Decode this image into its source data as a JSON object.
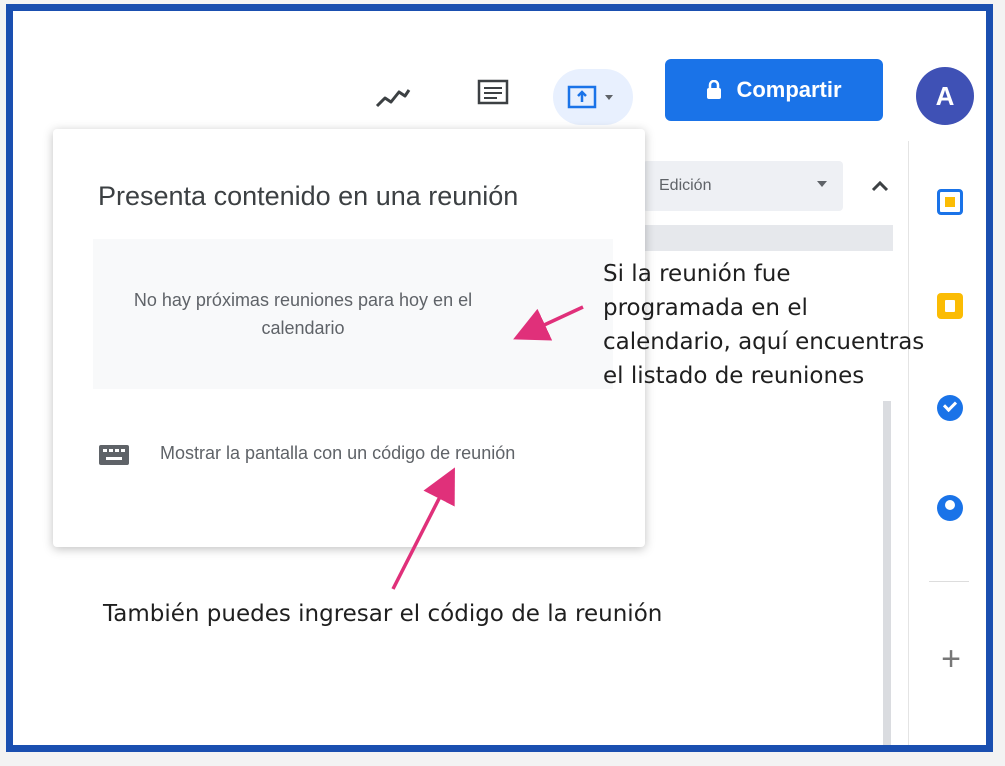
{
  "toolbar": {
    "share_label": "Compartir",
    "avatar_initial": "A"
  },
  "doc": {
    "mode_label": "Edición"
  },
  "popup": {
    "title": "Presenta contenido en una reunión",
    "no_meetings": "No hay próximas reuniones para hoy en el calendario",
    "code_option": "Mostrar la pantalla con un código de reunión"
  },
  "annotations": {
    "right": "Si la reunión fue programada en el calendario, aquí encuentras el listado de reuniones",
    "bottom": "También puedes ingresar el código de la reunión"
  },
  "side_panel": {
    "add_label": "+"
  },
  "colors": {
    "frame": "#1a4fb0",
    "share": "#1a73e8",
    "avatar": "#3f51b5",
    "arrow": "#e0307a"
  },
  "icons": [
    "activity-icon",
    "comments-icon",
    "present-icon",
    "lock-icon",
    "calendar-icon",
    "keep-icon",
    "tasks-icon",
    "contacts-icon",
    "keyboard-icon",
    "chevron-up-icon"
  ]
}
